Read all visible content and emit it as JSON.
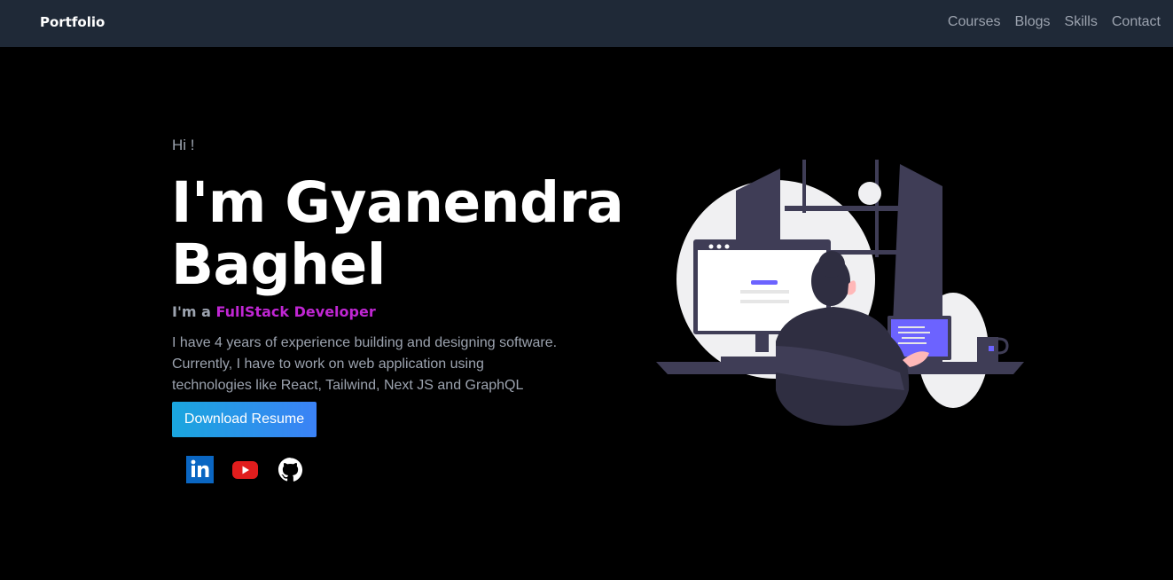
{
  "navbar": {
    "brand": "Portfolio",
    "links": [
      "Courses",
      "Blogs",
      "Skills",
      "Contact"
    ]
  },
  "hero": {
    "greeting": "Hi !",
    "headline_line1": "I'm Gyanendra",
    "headline_line2": "Baghel",
    "role_prefix": "I'm a",
    "role_highlight": "FullStack Developer",
    "bio_line1": "I have 4 years of experience building and designing software.",
    "bio_line2": "Currently, I have to work on web application using",
    "bio_line3": "technologies like React, Tailwind, Next JS and GraphQL",
    "cta_label": "Download Resume"
  },
  "socials": {
    "icons": [
      "linkedin-icon",
      "youtube-icon",
      "github-icon"
    ]
  },
  "colors": {
    "navbar_bg": "#1f2937",
    "accent": "#c026d3",
    "button_gradient_start": "#1aa6de",
    "button_gradient_end": "#3b82f6"
  }
}
